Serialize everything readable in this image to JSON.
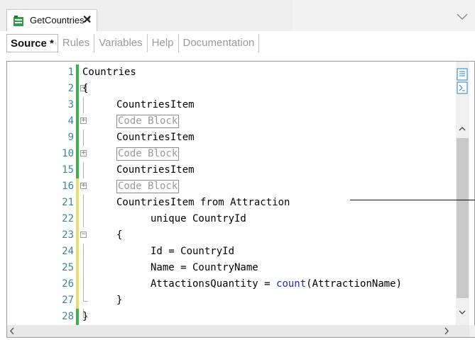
{
  "tab": {
    "title": "GetCountries *",
    "close": "✕"
  },
  "subtabs": [
    {
      "label": "Source *",
      "active": true
    },
    {
      "label": "Rules",
      "active": false
    },
    {
      "label": "Variables",
      "active": false
    },
    {
      "label": "Help",
      "active": false
    },
    {
      "label": "Documentation",
      "active": false
    }
  ],
  "lines": [
    {
      "n": "1",
      "bar": "green",
      "fold": "",
      "indent": 0,
      "parts": [
        {
          "t": "Countries"
        }
      ]
    },
    {
      "n": "2",
      "bar": "green",
      "fold": "-",
      "indent": 0,
      "parts": [
        {
          "t": "{"
        }
      ]
    },
    {
      "n": "3",
      "bar": "green",
      "fold": "|",
      "indent": 1,
      "parts": [
        {
          "t": "CountriesItem"
        }
      ]
    },
    {
      "n": "4",
      "bar": "green",
      "fold": "+",
      "indent": 1,
      "parts": [
        {
          "t": "Code Block",
          "block": true
        }
      ]
    },
    {
      "n": "9",
      "bar": "green",
      "fold": "|",
      "indent": 1,
      "parts": [
        {
          "t": "CountriesItem"
        }
      ]
    },
    {
      "n": "10",
      "bar": "green",
      "fold": "+",
      "indent": 1,
      "parts": [
        {
          "t": "Code Block",
          "block": true
        }
      ]
    },
    {
      "n": "15",
      "bar": "green",
      "fold": "|",
      "indent": 1,
      "parts": [
        {
          "t": "CountriesItem"
        }
      ]
    },
    {
      "n": "16",
      "bar": "yellow",
      "fold": "+",
      "indent": 1,
      "parts": [
        {
          "t": "Code Block",
          "block": true
        }
      ]
    },
    {
      "n": "21",
      "bar": "yellow",
      "fold": "|",
      "indent": 1,
      "parts": [
        {
          "t": "CountriesItem from Attraction"
        }
      ]
    },
    {
      "n": "22",
      "bar": "yellow",
      "fold": "|",
      "indent": 2,
      "parts": [
        {
          "t": "unique CountryId"
        }
      ]
    },
    {
      "n": "23",
      "bar": "yellow",
      "fold": "-",
      "indent": 1,
      "parts": [
        {
          "t": "{"
        }
      ]
    },
    {
      "n": "24",
      "bar": "yellow",
      "fold": "|",
      "indent": 2,
      "parts": [
        {
          "t": "Id = CountryId"
        }
      ]
    },
    {
      "n": "25",
      "bar": "yellow",
      "fold": "|",
      "indent": 2,
      "parts": [
        {
          "t": "Name = CountryName"
        }
      ]
    },
    {
      "n": "26",
      "bar": "yellow",
      "fold": "|",
      "indent": 2,
      "parts": [
        {
          "t": "AttactionsQuantity = "
        },
        {
          "t": "count",
          "fn": true
        },
        {
          "t": "(AttractionName)"
        }
      ]
    },
    {
      "n": "27",
      "bar": "yellow",
      "fold": "L",
      "indent": 1,
      "parts": [
        {
          "t": "}"
        }
      ]
    },
    {
      "n": "28",
      "bar": "green",
      "fold": "L",
      "indent": 0,
      "parts": [
        {
          "t": "}"
        }
      ]
    }
  ],
  "colors": {
    "bar_green": "#3cb24a",
    "bar_yellow": "#e8dc6a",
    "line_number": "#3a8a92",
    "keyword_fn": "#1e2ab8"
  },
  "icons": [
    "object-icon",
    "close-icon",
    "chevron-down-icon",
    "outline-view-icon",
    "doc-view-icon",
    "scroll-up-icon",
    "scroll-down-icon",
    "scroll-left-icon",
    "scroll-right-icon"
  ]
}
